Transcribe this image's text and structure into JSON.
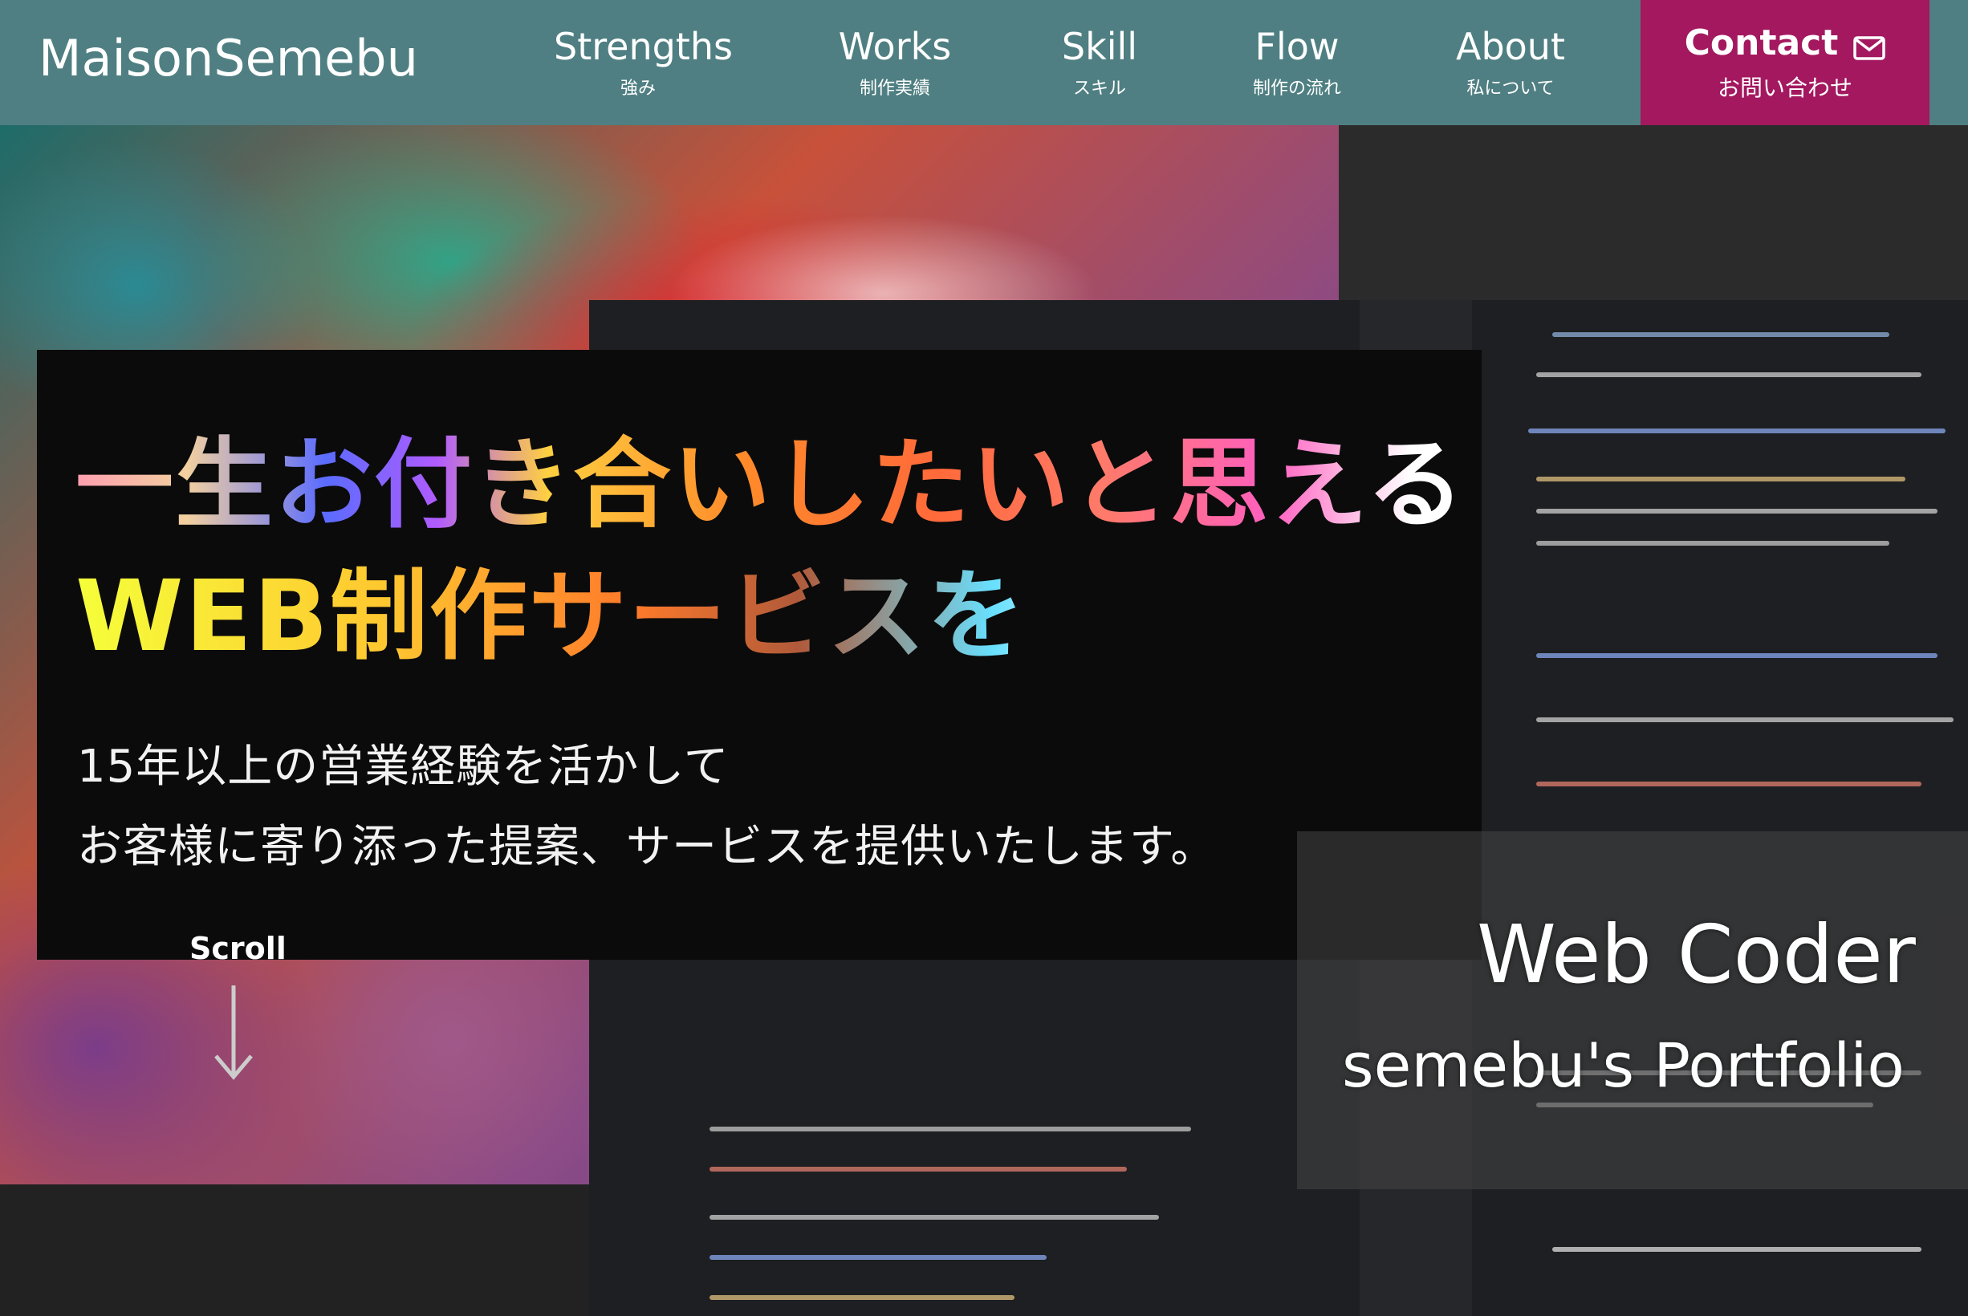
{
  "header": {
    "logo": "MaisonSemebu",
    "nav": [
      {
        "en": "Strengths",
        "ja": "強み"
      },
      {
        "en": "Works",
        "ja": "制作実績"
      },
      {
        "en": "Skill",
        "ja": "スキル"
      },
      {
        "en": "Flow",
        "ja": "制作の流れ"
      },
      {
        "en": "About",
        "ja": "私について"
      }
    ],
    "contact": {
      "en": "Contact",
      "ja": "お問い合わせ",
      "icon": "mail-icon"
    }
  },
  "hero": {
    "title_line1": "一生お付き合いしたいと思える",
    "title_line2": "WEB制作サービスを",
    "sub_line1": "15年以上の営業経験を活かして",
    "sub_line2": "お客様に寄り添った提案、サービスを提供いたします。"
  },
  "scroll": {
    "label": "Scroll",
    "icon": "arrow-down-icon"
  },
  "coder": {
    "title": "Web Coder",
    "subtitle": "semebu's Portfolio"
  },
  "colors": {
    "header_bg": "#4f7f82",
    "contact_bg": "#a3185f",
    "hero_box_bg": "#0b0b0b"
  }
}
